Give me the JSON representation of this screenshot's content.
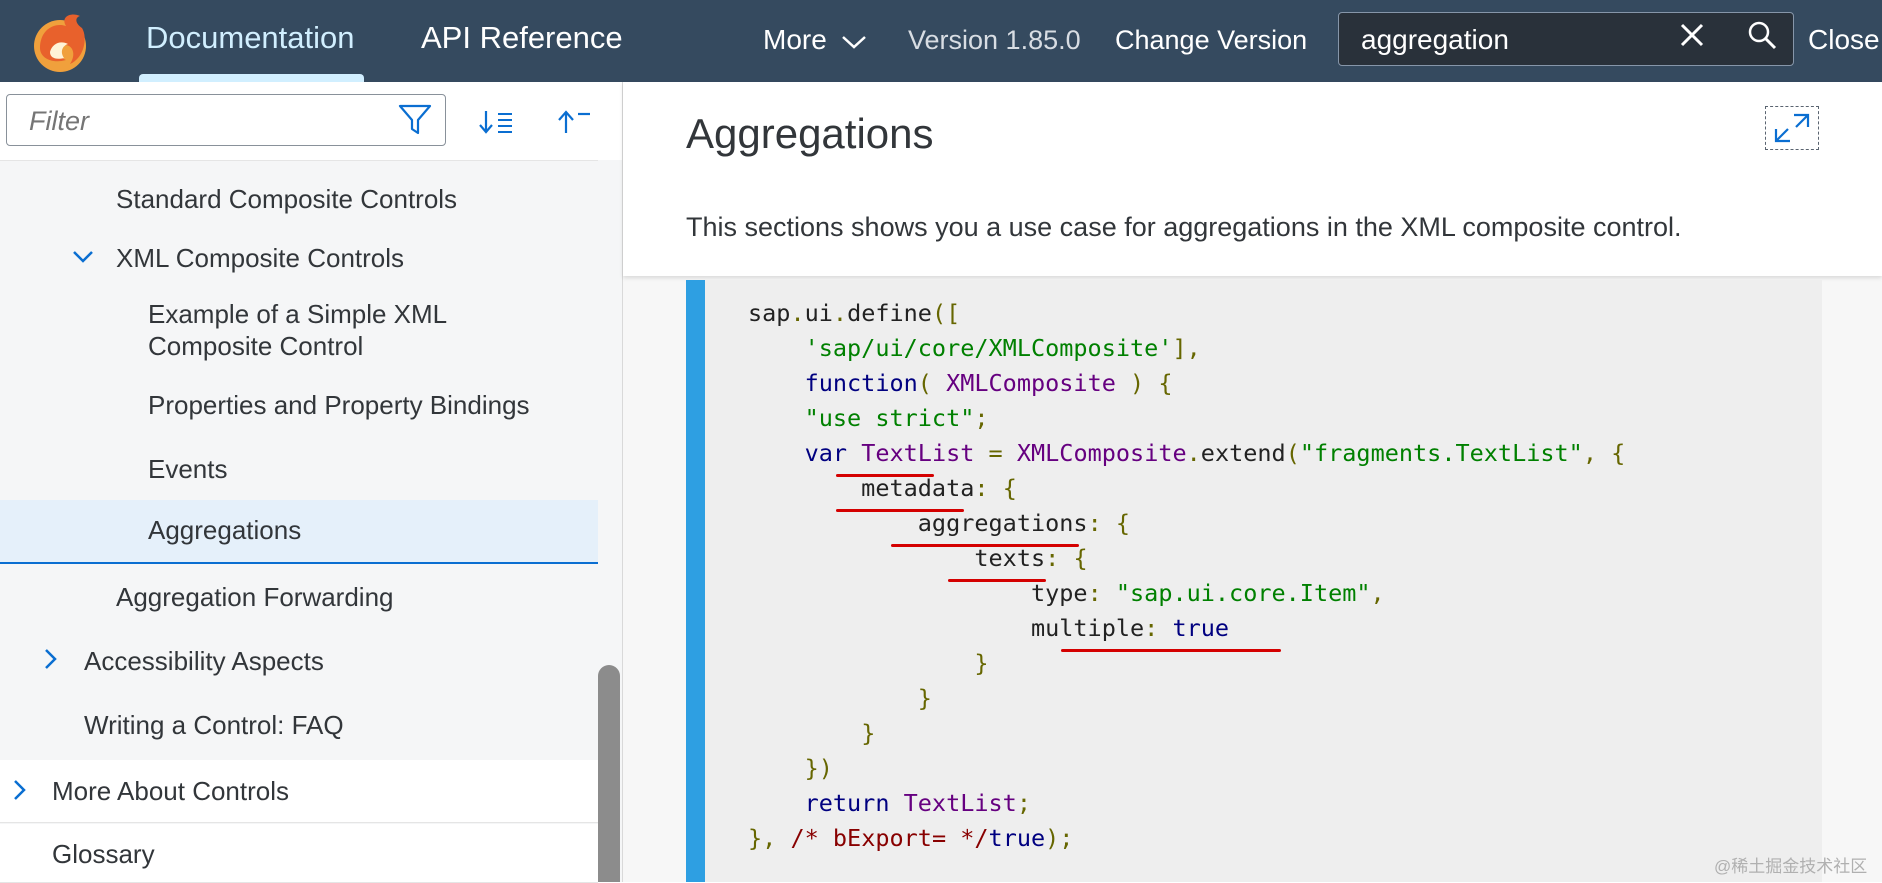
{
  "shellbar": {
    "tabs": [
      {
        "label": "Documentation"
      },
      {
        "label": "API Reference"
      }
    ],
    "more_label": "More",
    "version_label": "Version 1.85.0",
    "change_version_label": "Change Version",
    "search_value": "aggregation",
    "close_label": "Close"
  },
  "sidebar": {
    "filter_placeholder": "Filter",
    "items": [
      {
        "label": "Standard Composite Controls"
      },
      {
        "label": "XML Composite Controls"
      },
      {
        "label": "Example of a Simple XML"
      },
      {
        "label": "Composite Control"
      },
      {
        "label": "Properties and Property Bindings"
      },
      {
        "label": "Events"
      },
      {
        "label": "Aggregations"
      },
      {
        "label": "Aggregation Forwarding"
      },
      {
        "label": "Accessibility Aspects"
      },
      {
        "label": "Writing a Control: FAQ"
      },
      {
        "label": "More About Controls"
      },
      {
        "label": "Glossary"
      }
    ]
  },
  "main": {
    "title": "Aggregations",
    "description": "This sections shows you a use case for aggregations in the XML composite control.",
    "code_lines": [
      "sap.ui.define([",
      "    'sap/ui/core/XMLComposite'],",
      "    function( XMLComposite ) {",
      "    \"use strict\";",
      "    var TextList = XMLComposite.extend(\"fragments.TextList\", {",
      "        metadata: {",
      "            aggregations: {",
      "                texts: {",
      "                    type: \"sap.ui.core.Item\",",
      "                    multiple: true",
      "                }",
      "            }",
      "        }",
      "    })",
      "    return TextList;",
      "}, /* bExport= */true);"
    ]
  },
  "watermark": "@稀土掘金技术社区",
  "colors": {
    "shell_bg": "#354a5f",
    "accent": "#0a6ed1",
    "code_bar": "#2e9fe2",
    "highlight_underline": "#d40000"
  },
  "icons": [
    "logo",
    "chevron-down-icon",
    "clear-icon",
    "search-icon",
    "filter-icon",
    "sort-icon",
    "collapse-icon",
    "expand-icon",
    "fullscreen-icon"
  ]
}
